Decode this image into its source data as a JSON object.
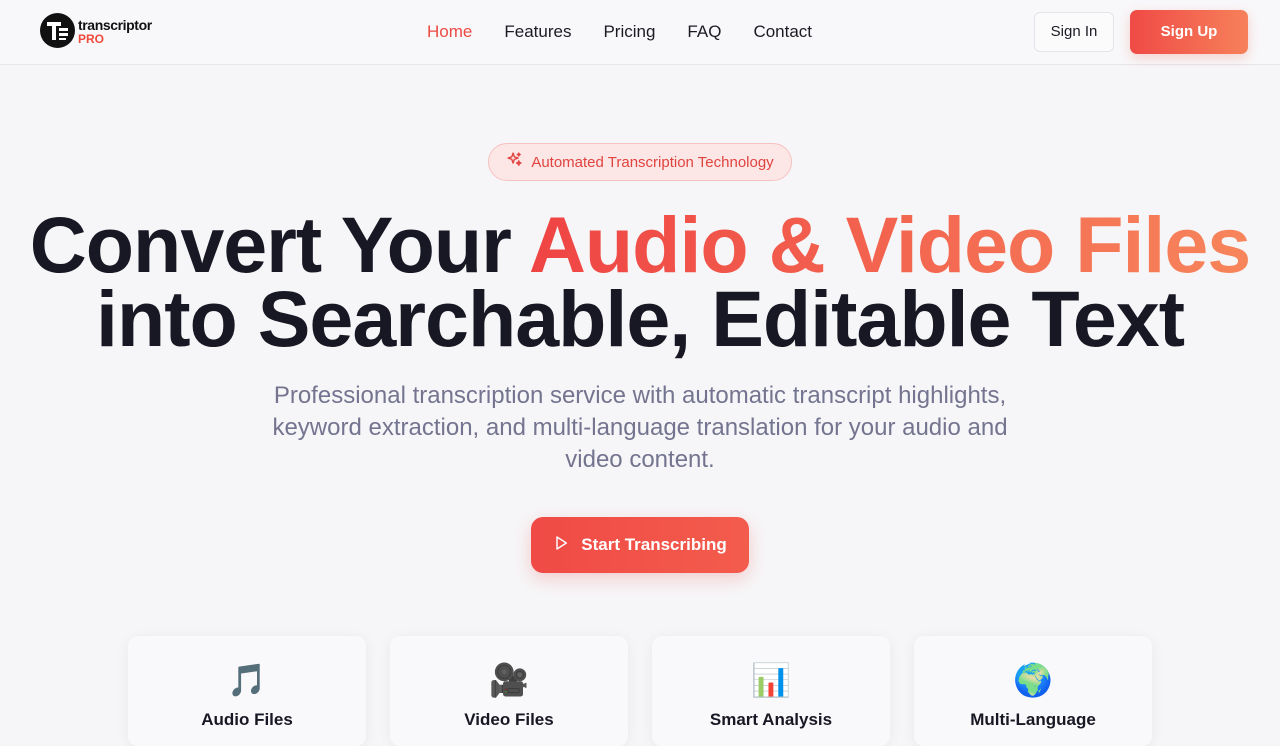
{
  "logo": {
    "text": "transcriptor",
    "sub": "PRO"
  },
  "nav": {
    "links": [
      "Home",
      "Features",
      "Pricing",
      "FAQ",
      "Contact"
    ],
    "active": "Home",
    "sign_in": "Sign In",
    "sign_up": "Sign Up"
  },
  "hero": {
    "badge": "Automated Transcription Technology",
    "headline_part1": "Convert Your ",
    "headline_highlight": "Audio & Video Files",
    "headline_part2": "into Searchable, Editable Text",
    "subtitle": "Professional transcription service with automatic transcript highlights, keyword extraction, and multi-language translation for your audio and video content.",
    "cta": "Start Transcribing"
  },
  "features": [
    {
      "icon": "🎵",
      "icon_name": "music-note-icon",
      "title": "Audio Files"
    },
    {
      "icon": "🎥",
      "icon_name": "video-camera-icon",
      "title": "Video Files"
    },
    {
      "icon": "📊",
      "icon_name": "bar-chart-icon",
      "title": "Smart Analysis"
    },
    {
      "icon": "🌍",
      "icon_name": "globe-icon",
      "title": "Multi-Language"
    }
  ],
  "colors": {
    "accent": "#ef4444",
    "accent_end": "#f7855b",
    "text_dark": "#181824",
    "text_muted": "#747490"
  }
}
